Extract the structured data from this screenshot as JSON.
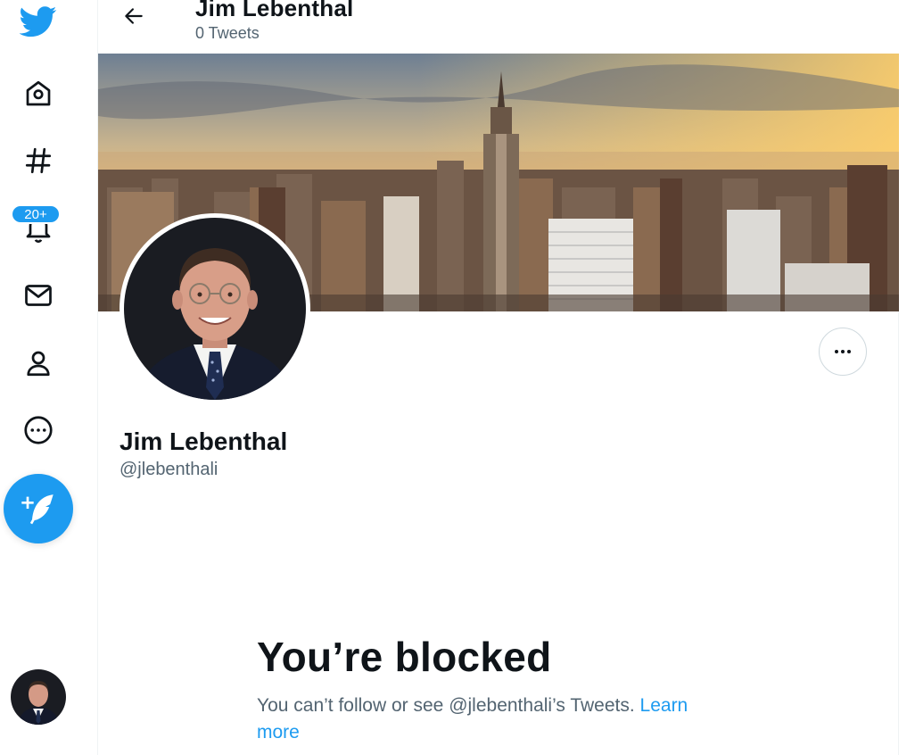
{
  "nav": {
    "items": [
      {
        "name": "twitter-logo-icon"
      },
      {
        "name": "home-icon"
      },
      {
        "name": "explore-hashtag-icon"
      },
      {
        "name": "notifications-bell-icon"
      },
      {
        "name": "messages-envelope-icon"
      },
      {
        "name": "profile-person-icon"
      },
      {
        "name": "more-circle-icon"
      }
    ],
    "notifications_badge": "20+",
    "compose_icon": "feather-plus-icon"
  },
  "header": {
    "title": "Jim Lebenthal",
    "subtitle": "0 Tweets",
    "back_icon": "arrow-left-icon"
  },
  "profile": {
    "display_name": "Jim Lebenthal",
    "handle": "@jlebenthali",
    "more_icon": "ellipsis-icon"
  },
  "blocked": {
    "title": "You’re blocked",
    "message": "You can’t follow or see @jlebenthali’s Tweets.",
    "link_line1": "Learn",
    "link_line2": "more"
  },
  "colors": {
    "accent": "#1d9bf0",
    "text_primary": "#0f1419",
    "text_secondary": "#536471",
    "border": "#cfd9de"
  }
}
